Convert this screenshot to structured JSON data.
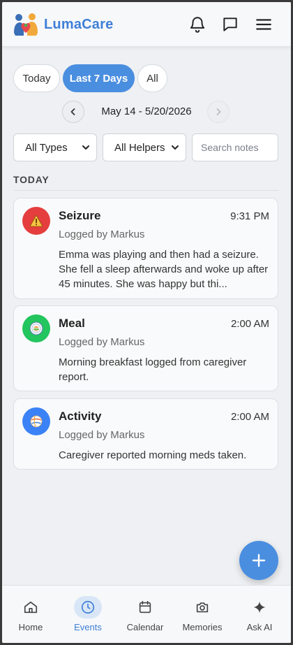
{
  "app": {
    "name": "LumaCare"
  },
  "colors": {
    "accent": "#4a8ee0",
    "seizure": "#e53e3e",
    "meal": "#22c55e",
    "activity": "#3b82f6"
  },
  "header": {
    "icons": [
      "bell-icon",
      "chat-icon",
      "menu-icon"
    ]
  },
  "range_tabs": [
    {
      "label": "Today",
      "active": false
    },
    {
      "label": "Last 7 Days",
      "active": true
    },
    {
      "label": "All",
      "active": false
    }
  ],
  "date_range": "May 14 - 5/20/2026",
  "filters": {
    "type_selected": "All Types",
    "helper_selected": "All Helpers",
    "search_placeholder": "Search notes"
  },
  "section_label": "TODAY",
  "events": [
    {
      "type": "Seizure",
      "icon": "warning-icon",
      "time": "9:31 PM",
      "logged_by": "Logged by Markus",
      "description": "Emma was playing and then had a seizure. She fell a sleep afterwards and woke up after 45 minutes. She was happy but thi..."
    },
    {
      "type": "Meal",
      "icon": "meal-plate-icon",
      "time": "2:00 AM",
      "logged_by": "Logged by Markus",
      "description": "Morning breakfast logged from caregiver report."
    },
    {
      "type": "Activity",
      "icon": "ball-icon",
      "time": "2:00 AM",
      "logged_by": "Logged by Markus",
      "description": "Caregiver reported morning meds taken."
    }
  ],
  "bottom_nav": [
    {
      "label": "Home",
      "icon": "home-icon",
      "active": false
    },
    {
      "label": "Events",
      "icon": "clock-icon",
      "active": true
    },
    {
      "label": "Calendar",
      "icon": "calendar-icon",
      "active": false
    },
    {
      "label": "Memories",
      "icon": "camera-icon",
      "active": false
    },
    {
      "label": "Ask AI",
      "icon": "sparkle-icon",
      "active": false
    }
  ]
}
